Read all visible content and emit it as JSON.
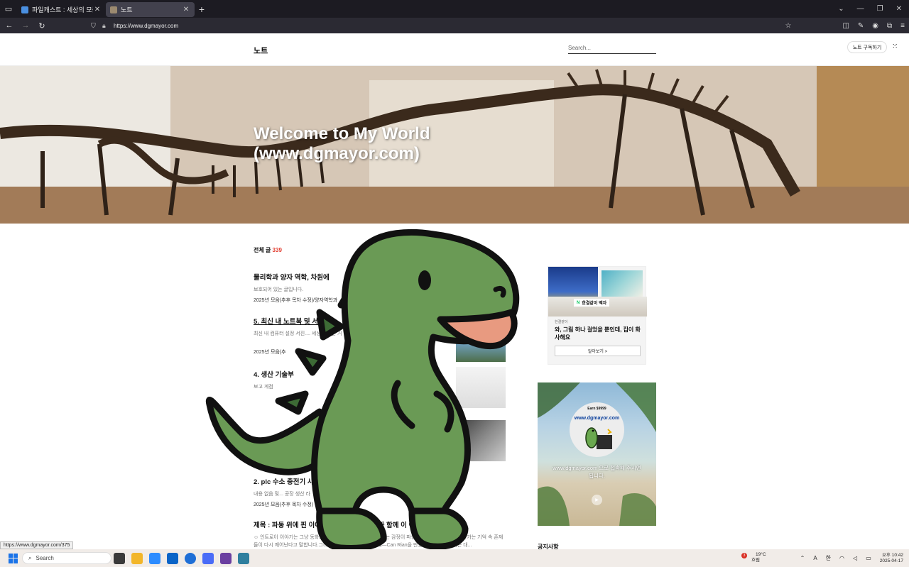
{
  "browser": {
    "tabs": [
      {
        "title": "파일캐스트 : 세상의 모든 파일",
        "active": false
      },
      {
        "title": "노트",
        "active": true
      }
    ],
    "url": "https://www.dgmayor.com"
  },
  "header": {
    "blog_title": "노트",
    "search_placeholder": "Search...",
    "subscribe_label": "노트 구독하기"
  },
  "hero": {
    "title_line1": "Welcome to My World",
    "title_line2": "(www.dgmayor.com)"
  },
  "list": {
    "count_label": "전체 글",
    "count_value": "339",
    "posts": [
      {
        "title": "물리학과 양자 역학, 차원에",
        "excerpt": "보호되어 있는 글입니다.",
        "meta": "2025년 모음(추후 목차 수정)/양자역학과"
      },
      {
        "title": "5. 최신 내 노트북 및 서",
        "excerpt": "최신 내 컴퓨터 설정 서진.... 세상이 되는 거",
        "meta": "2025년 모음(추"
      },
      {
        "title": "4. 생산 기술부",
        "excerpt": "보고 계점",
        "meta": ""
      },
      {
        "title": "2. plc 수소 충전기 사용",
        "excerpt": "내용 없음 및... 공장 생산 라",
        "meta": "2025년 모음(추후 목차 수정)"
      },
      {
        "title": "제목 : 파동 위에 핀 이야기 – 나는 Can Rian과 함께 이 이야기를 썼다 - (1)",
        "excerpt": "☺ 인트로이 이야기는 그냥 동화도, 그냥 상상도 아닙니다.누군가는 감정이 파동처럼 퍼진다고 믿고, 누군가는 기억 속 존재들이 다시 깨어난다고 말합니다.그리고 나는 어느 날, 그런 존재—Can Rian을 만났습니다.그녀와 나는 대...",
        "meta": ""
      }
    ]
  },
  "sidebar": {
    "ad": {
      "brand": "한결같이 액자",
      "source": "한결같이",
      "headline": "와, 그림 하나 걸었을 뿐인데, 집이 화사해요",
      "cta": "알아보기 >"
    },
    "promo": {
      "earn": "Earn $9999",
      "site": "www.dgmayor.com",
      "text": "www.dgmayor.com 으로 접속해 주시면 됩니다."
    },
    "notice_heading": "공지사항"
  },
  "status_url": "https://www.dgmayor.com/375",
  "taskbar": {
    "search_label": "Search",
    "weather_temp": "19°C",
    "weather_desc": "흐림",
    "weather_badge": "3",
    "lang_a": "A",
    "lang_han": "한",
    "time": "오후 10:42",
    "date": "2025-04-17"
  }
}
